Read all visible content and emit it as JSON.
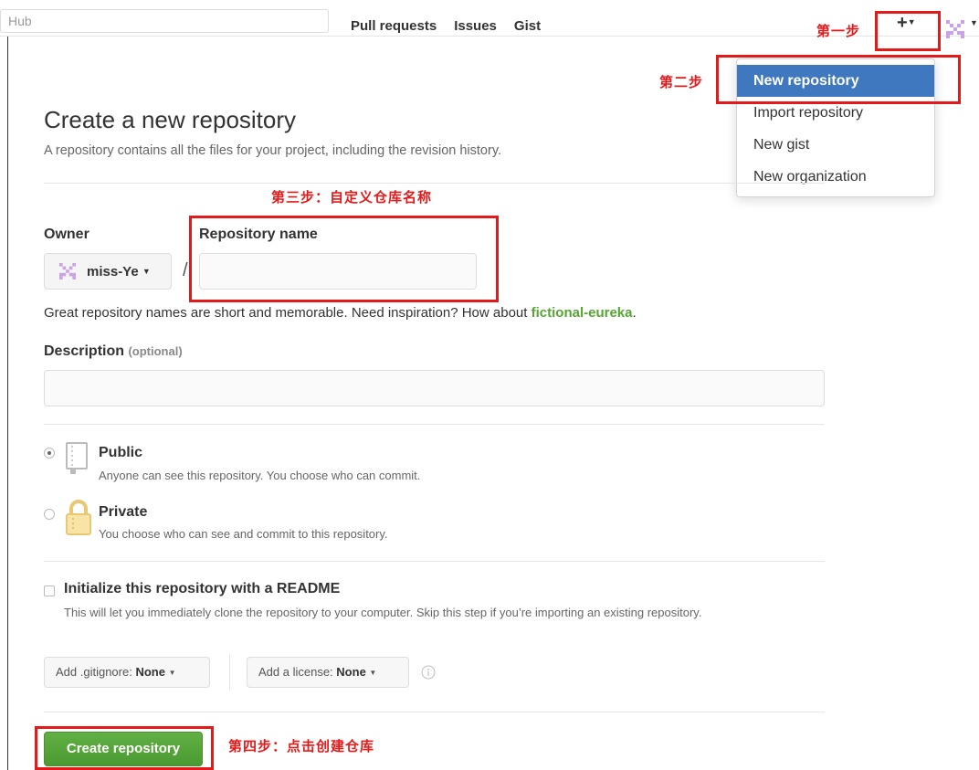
{
  "header": {
    "search_text": "Hub",
    "nav": [
      "Pull requests",
      "Issues",
      "Gist"
    ],
    "plus_label": "+"
  },
  "dropdown": {
    "items": [
      "New repository",
      "Import repository",
      "New gist",
      "New organization"
    ]
  },
  "annotations": {
    "step1": "第一步",
    "step2": "第二步",
    "step3": "第三步：自定义仓库名称",
    "step4": "第四步：点击创建仓库"
  },
  "main": {
    "title": "Create a new repository",
    "subtitle": "A repository contains all the files for your project, including the revision history.",
    "owner_label": "Owner",
    "owner_value": "miss-Ye",
    "repo_name_label": "Repository name",
    "repo_name_value": "",
    "slash": "/",
    "hint_prefix": "Great repository names are short and memorable. Need inspiration? How about ",
    "hint_suggestion": "fictional-eureka",
    "hint_suffix": ".",
    "description_label": "Description",
    "description_optional": "(optional)",
    "description_value": "",
    "visibility": {
      "selected": "public",
      "public_title": "Public",
      "public_desc": "Anyone can see this repository. You choose who can commit.",
      "private_title": "Private",
      "private_desc": "You choose who can see and commit to this repository."
    },
    "readme_checked": false,
    "readme_title": "Initialize this repository with a README",
    "readme_desc": "This will let you immediately clone the repository to your computer. Skip this step if you’re importing an existing repository.",
    "gitignore_prefix": "Add .gitignore:",
    "gitignore_value": "None",
    "license_prefix": "Add a license:",
    "license_value": "None",
    "create_button": "Create repository"
  },
  "colors": {
    "accent_blue": "#4078c0",
    "create_green": "#55a532",
    "annotation_red": "#e21a1a"
  }
}
